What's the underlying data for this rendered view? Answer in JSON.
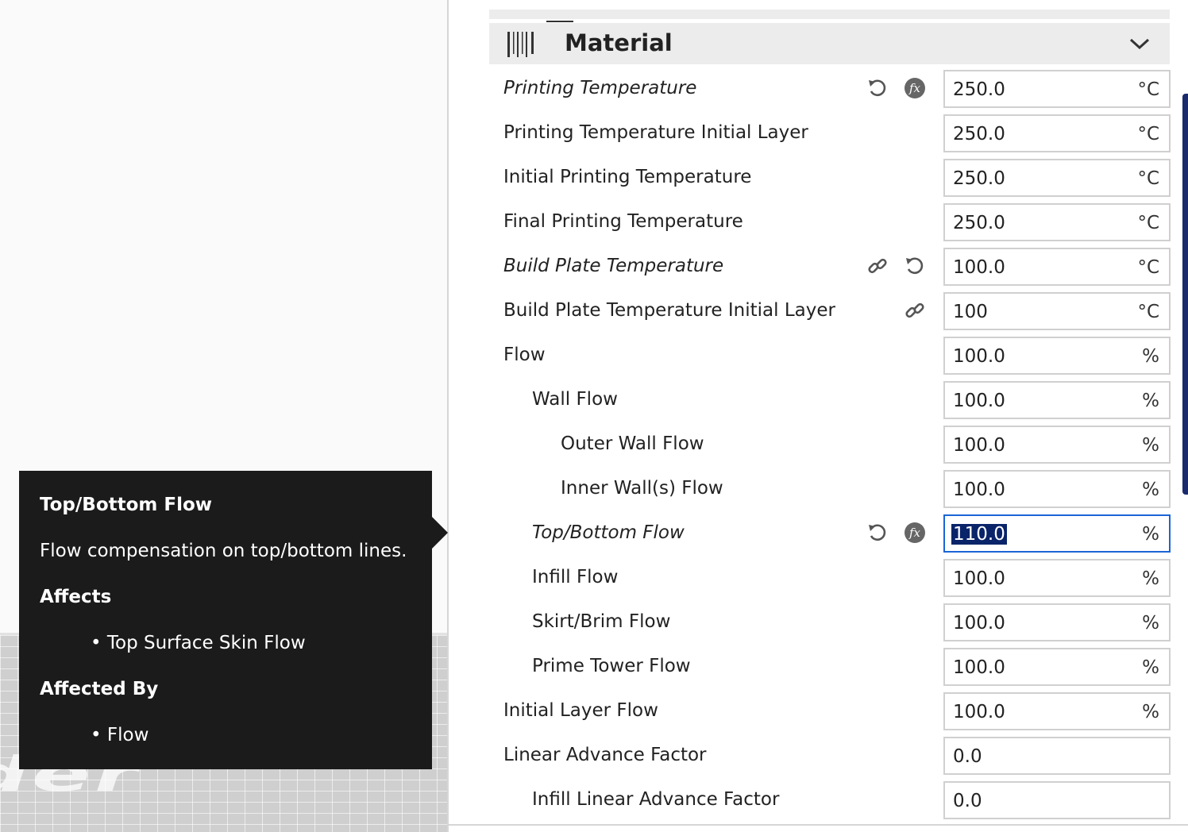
{
  "section": {
    "title": "Material"
  },
  "tooltip": {
    "title": "Top/Bottom Flow",
    "description": "Flow compensation on top/bottom lines.",
    "affects_heading": "Affects",
    "affects": [
      "• Top Surface Skin Flow"
    ],
    "affected_by_heading": "Affected By",
    "affected_by": [
      "• Flow"
    ]
  },
  "viewport": {
    "watermark": "der"
  },
  "settings": [
    {
      "label": "Printing Temperature",
      "value": "250.0",
      "unit": "°C"
    },
    {
      "label": "Printing Temperature Initial Layer",
      "value": "250.0",
      "unit": "°C"
    },
    {
      "label": "Initial Printing Temperature",
      "value": "250.0",
      "unit": "°C"
    },
    {
      "label": "Final Printing Temperature",
      "value": "250.0",
      "unit": "°C"
    },
    {
      "label": "Build Plate Temperature",
      "value": "100.0",
      "unit": "°C"
    },
    {
      "label": "Build Plate Temperature Initial Layer",
      "value": "100",
      "unit": "°C"
    },
    {
      "label": "Flow",
      "value": "100.0",
      "unit": "%"
    },
    {
      "label": "Wall Flow",
      "value": "100.0",
      "unit": "%"
    },
    {
      "label": "Outer Wall Flow",
      "value": "100.0",
      "unit": "%"
    },
    {
      "label": "Inner Wall(s) Flow",
      "value": "100.0",
      "unit": "%"
    },
    {
      "label": "Top/Bottom Flow",
      "value": "110.0",
      "unit": "%"
    },
    {
      "label": "Infill Flow",
      "value": "100.0",
      "unit": "%"
    },
    {
      "label": "Skirt/Brim Flow",
      "value": "100.0",
      "unit": "%"
    },
    {
      "label": "Prime Tower Flow",
      "value": "100.0",
      "unit": "%"
    },
    {
      "label": "Initial Layer Flow",
      "value": "100.0",
      "unit": "%"
    },
    {
      "label": "Linear Advance Factor",
      "value": "0.0",
      "unit": ""
    },
    {
      "label": "Infill Linear Advance Factor",
      "value": "0.0",
      "unit": ""
    }
  ],
  "colors": {
    "accent": "#1b64d6",
    "selection": "#0a246a",
    "tooltip_bg": "#1b1b1b",
    "header_bg": "#ececec"
  }
}
